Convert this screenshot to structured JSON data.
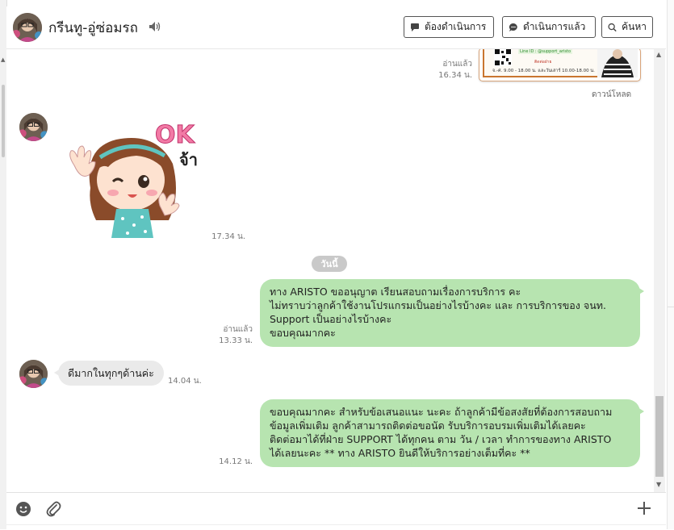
{
  "header": {
    "chat_title": "กรีนทู-อู่ซ่อมรถ",
    "buttons": {
      "todo": "ต้องดำเนินการ",
      "done": "ดำเนินการแล้ว",
      "search": "ค้นหา"
    }
  },
  "messages": {
    "image_message": {
      "line_id_text": "Line ID : @support_aristo",
      "hours_text": "จ.-ศ. 9.00 - 18.00 น. และวันเสาร์ 10.00-18.00 น.",
      "read_status": "อ่านแล้ว",
      "time": "16.34 น.",
      "download_label": "ดาวน์โหลด"
    },
    "sticker": {
      "text_ok": "OK",
      "text_ja": "จ้า",
      "time": "17.34 น."
    },
    "date_separator": "วันนี้",
    "outgoing_1": {
      "lines": [
        "ทาง ARISTO ขออนุญาต เรียนสอบถามเรื่องการบริการ คะ",
        "ไม่ทราบว่าลูกค้าใช้งานโปรแกรมเป็นอย่างไรบ้างคะ และ การบริการของ จนท.",
        "Support เป็นอย่างไรบ้างคะ",
        "ขอบคุณมากคะ"
      ],
      "read_status": "อ่านแล้ว",
      "time": "13.33 น."
    },
    "incoming_1": {
      "text": "ดีมากในทุกๆด้านค่ะ",
      "time": "14.04 น."
    },
    "outgoing_2": {
      "lines": [
        "ขอบคุณมากคะ สำหรับข้อเสนอแนะ นะคะ ถ้าลูกค้ามีข้อสงสัยที่ต้องการสอบถาม",
        "ข้อมูลเพิ่มเติม ลูกค้าสามารถติดต่อขอนัด รับบริการอบรมเพิ่มเติมได้เลยคะ",
        "ติดต่อมาได้ที่ฝ่าย SUPPORT ได้ทุกคน ตาม วัน / เวลา ทำการของทาง ARISTO",
        "ได้เลยนะคะ ** ทาง ARISTO ยินดีให้บริการอย่างเต็มที่คะ **"
      ],
      "time": "14.12 น."
    }
  },
  "colors": {
    "outgoing_bubble": "#b7e4b0",
    "incoming_bubble": "#eaeaea",
    "date_pill": "#c9c9c9"
  },
  "icons": {
    "mute": "speaker-icon",
    "todo": "speech-bubble-icon",
    "done": "chat-bubble-dots-icon",
    "search": "search-icon",
    "emoji": "smiley-icon",
    "attach": "paperclip-icon",
    "more": "plus-icon"
  }
}
